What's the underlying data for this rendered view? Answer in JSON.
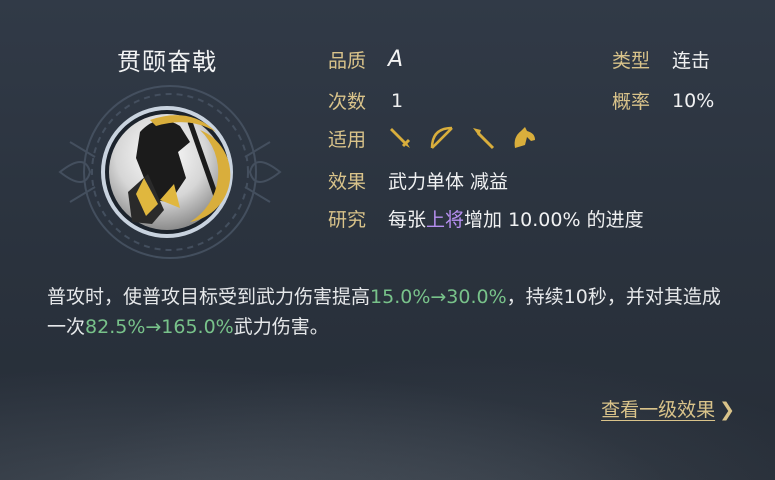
{
  "skill": {
    "name": "贯颐奋戟",
    "quality_label": "品质",
    "quality_value": "A",
    "type_label": "类型",
    "type_value": "连击",
    "count_label": "次数",
    "count_value": "1",
    "rate_label": "概率",
    "rate_value": "10%",
    "applies_label": "适用",
    "applies_icons": [
      "sword-icon",
      "bow-icon",
      "spear-icon",
      "horse-icon"
    ],
    "effect_label": "效果",
    "effect_value": "武力单体 减益",
    "research_label": "研究",
    "research_pre": "每张",
    "research_highlight": "上将",
    "research_post": "增加 10.00% 的进度"
  },
  "description": {
    "p1": "普攻时，使普攻目标受到武力伤害提高",
    "v1": "15.0%→30.0%",
    "p2": "，持续10秒，并对其造成一次",
    "v2": "82.5%→165.0%",
    "p3": "武力伤害。"
  },
  "link": {
    "label": "查看一级效果",
    "arrow": "❯"
  },
  "colors": {
    "label_gold": "#d9c38a",
    "highlight_purple": "#b68ff0",
    "value_green": "#78c28a"
  }
}
